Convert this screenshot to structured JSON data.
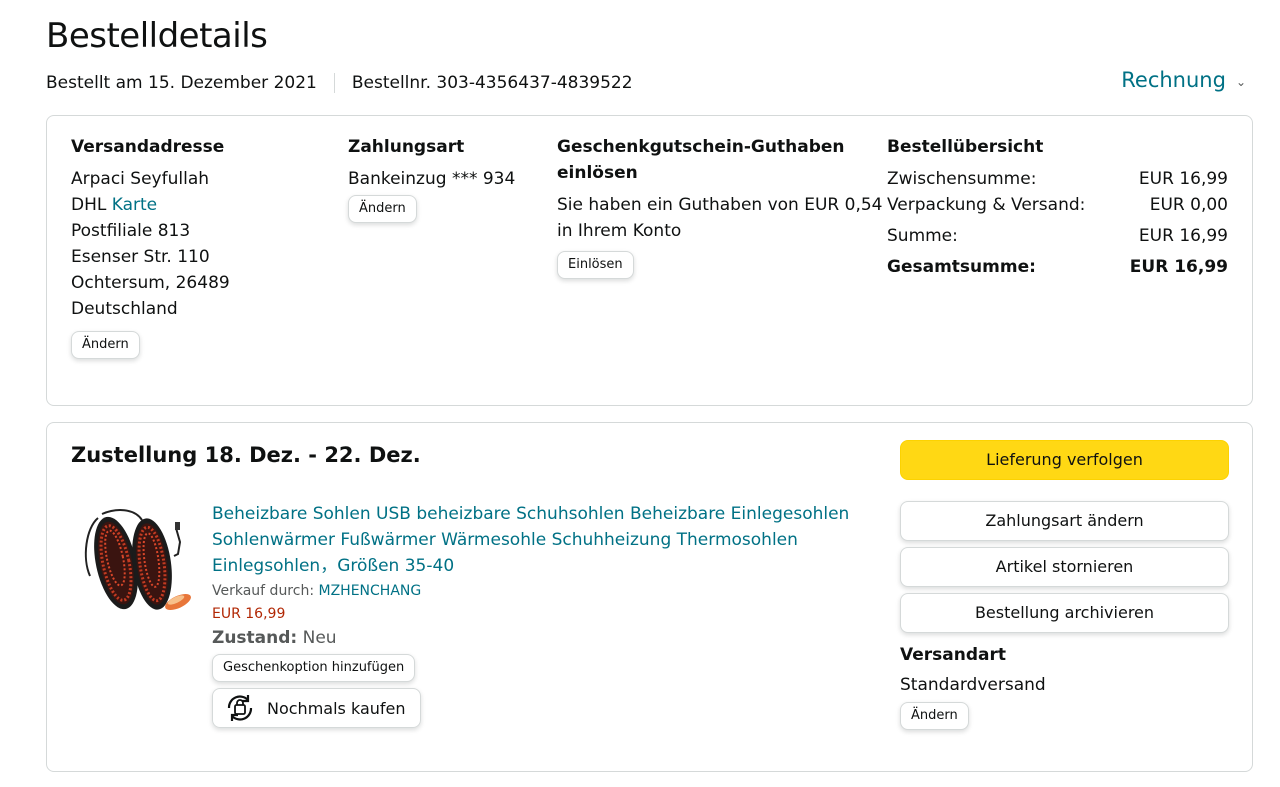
{
  "header": {
    "title": "Bestelldetails",
    "order_date": "Bestellt am 15. Dezember 2021",
    "order_number": "Bestellnr. 303-4356437-4839522",
    "invoice_label": "Rechnung"
  },
  "shipping_address": {
    "heading": "Versandadresse",
    "name": "Arpaci Seyfullah",
    "carrier_prefix": "DHL",
    "carrier_link": "Karte",
    "line1": "Postfiliale 813",
    "line2": "Esenser Str. 110",
    "line3": "Ochtersum, 26489",
    "country": "Deutschland",
    "change_label": "Ändern"
  },
  "payment": {
    "heading": "Zahlungsart",
    "method": "Bankeinzug *** 934",
    "change_label": "Ändern"
  },
  "gift_card": {
    "heading_line1": "Geschenkgutschein-Guthaben",
    "heading_line2": "einlösen",
    "text_line1": "Sie haben ein Guthaben von EUR 0,54",
    "text_line2": "in Ihrem Konto",
    "redeem_label": "Einlösen"
  },
  "summary": {
    "heading": "Bestellübersicht",
    "rows": [
      {
        "label": "Zwischensumme:",
        "value": "EUR 16,99"
      },
      {
        "label": "Verpackung & Versand:",
        "value": "EUR 0,00"
      },
      {
        "label": "Summe:",
        "value": "EUR 16,99"
      }
    ],
    "total_label": "Gesamtsumme:",
    "total_value": "EUR 16,99"
  },
  "delivery": {
    "title": "Zustellung 18. Dez. - 22. Dez.",
    "product_title_line1": "Beheizbare Sohlen USB beheizbare Schuhsohlen Beheizbare Einlegesohlen",
    "product_title_line2": "Sohlenwärmer Fußwärmer Wärmesohle Schuhheizung Thermosohlen",
    "product_title_line3": "Einlegsohlen，Größen 35-40",
    "sold_by_label": "Verkauf durch:",
    "seller": "MZHENCHANG",
    "price": "EUR 16,99",
    "condition_label": "Zustand:",
    "condition_value": "Neu",
    "gift_option_label": "Geschenkoption hinzufügen",
    "buy_again_label": "Nochmals kaufen"
  },
  "actions": {
    "track": "Lieferung verfolgen",
    "change_payment": "Zahlungsart ändern",
    "cancel_item": "Artikel stornieren",
    "archive_order": "Bestellung archivieren",
    "shipping_method_heading": "Versandart",
    "shipping_method_value": "Standardversand",
    "shipping_change_label": "Ändern"
  },
  "colors": {
    "link": "#007185",
    "price": "#B12704",
    "primary_button": "#FFD814",
    "border": "#D5D9D9"
  }
}
